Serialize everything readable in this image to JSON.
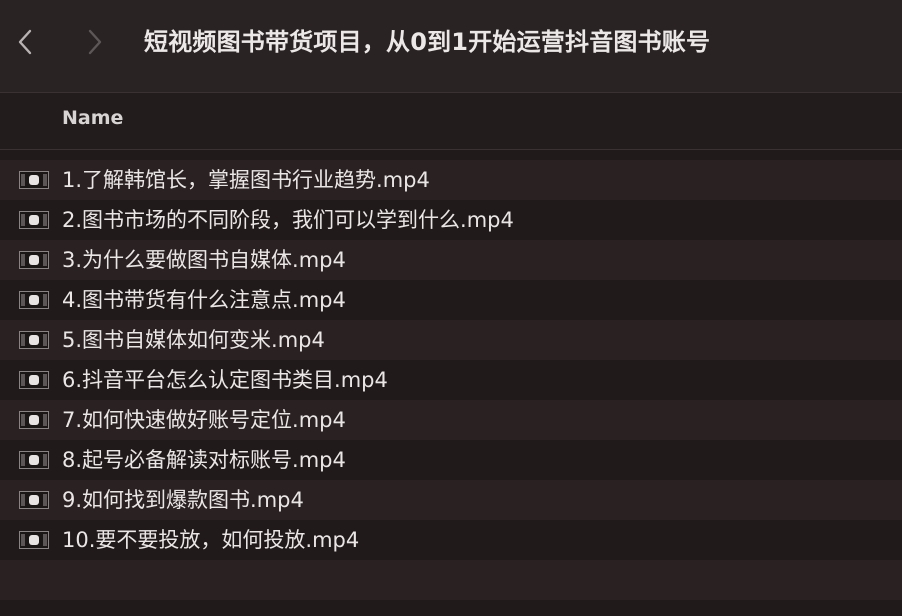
{
  "toolbar": {
    "title": "短视频图书带货项目，从0到1开始运营抖音图书账号",
    "back_icon": "chevron-left-icon",
    "forward_icon": "chevron-right-icon"
  },
  "list_header": {
    "name_column": "Name"
  },
  "files": [
    {
      "name": "1.了解韩馆长，掌握图书行业趋势.mp4",
      "icon": "video-file-icon"
    },
    {
      "name": "2.图书市场的不同阶段，我们可以学到什么.mp4",
      "icon": "video-file-icon"
    },
    {
      "name": "3.为什么要做图书自媒体.mp4",
      "icon": "video-file-icon"
    },
    {
      "name": "4.图书带货有什么注意点.mp4",
      "icon": "video-file-icon"
    },
    {
      "name": "5.图书自媒体如何变米.mp4",
      "icon": "video-file-icon"
    },
    {
      "name": "6.抖音平台怎么认定图书类目.mp4",
      "icon": "video-file-icon"
    },
    {
      "name": "7.如何快速做好账号定位.mp4",
      "icon": "video-file-icon"
    },
    {
      "name": "8.起号必备解读对标账号.mp4",
      "icon": "video-file-icon"
    },
    {
      "name": "9.如何找到爆款图书.mp4",
      "icon": "video-file-icon"
    },
    {
      "name": "10.要不要投放，如何投放.mp4",
      "icon": "video-file-icon"
    }
  ],
  "colors": {
    "background": "#201a1a",
    "toolbar": "#2a2323",
    "row_alt": "#2a2222",
    "text": "#ebe6e6"
  }
}
